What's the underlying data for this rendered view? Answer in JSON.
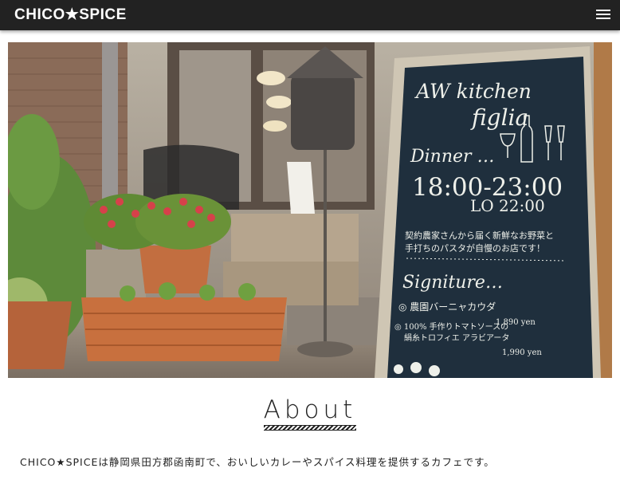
{
  "header": {
    "brand": "CHICO★SPICE",
    "menu_icon": "hamburger-menu-icon"
  },
  "hero": {
    "board": {
      "line1": "AW kitchen",
      "line2": "figlia",
      "dinner": "Dinner …",
      "hours": "18:00-23:00",
      "lo": "LO 22:00",
      "desc1": "契約農家さんから届く新鮮なお野菜と",
      "desc2": "手打ちのパスタが自慢のお店です！",
      "signature": "Signiture…",
      "item1": "◎ 農園バーニャカウダ",
      "price1": "1,890 yen",
      "item2a": "◎ 100% 手作りトマトソースの",
      "item2b": "絹糸トロフィエ アラビアータ",
      "price2": "1,990 yen"
    }
  },
  "about": {
    "title": "About",
    "text": "CHICO★SPICEは静岡県田方郡函南町で、おいしいカレーやスパイス料理を提供するカフェです。"
  },
  "colors": {
    "header_bg": "#222222",
    "chalkboard": "#1f2f3d",
    "text": "#222222"
  }
}
